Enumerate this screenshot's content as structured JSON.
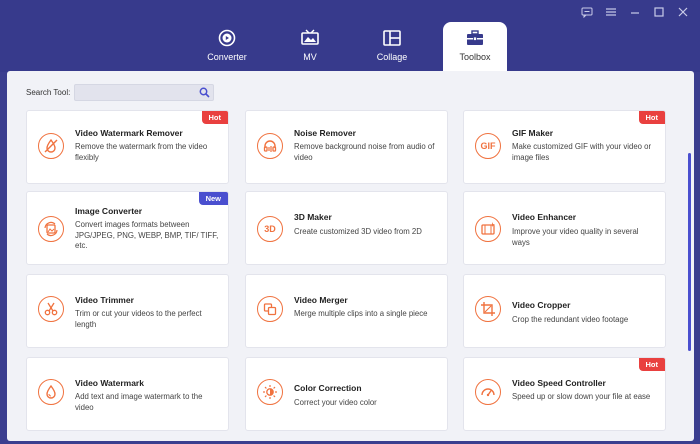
{
  "window": {
    "controls": [
      "feedback-icon",
      "menu-icon",
      "minimize-icon",
      "maximize-icon",
      "close-icon"
    ]
  },
  "tabs": [
    {
      "label": "Converter",
      "icon": "converter-icon",
      "active": false
    },
    {
      "label": "MV",
      "icon": "mv-icon",
      "active": false
    },
    {
      "label": "Collage",
      "icon": "collage-icon",
      "active": false
    },
    {
      "label": "Toolbox",
      "icon": "toolbox-icon",
      "active": true
    }
  ],
  "search": {
    "label": "Search Tool:",
    "value": ""
  },
  "colors": {
    "accent": "#f0723f",
    "hot": "#e9403f",
    "new": "#4a4fcf",
    "header": "#373a8c"
  },
  "tools": [
    {
      "title": "Video Watermark Remover",
      "desc": "Remove the watermark from the video flexibly",
      "badge": "Hot",
      "icon": "watermark-remove-icon"
    },
    {
      "title": "Noise Remover",
      "desc": "Remove background noise from audio of video",
      "badge": "",
      "icon": "noise-remover-icon"
    },
    {
      "title": "GIF Maker",
      "desc": "Make customized GIF with your video or image files",
      "badge": "Hot",
      "icon": "gif-icon"
    },
    {
      "title": "Image Converter",
      "desc": "Convert images formats between JPG/JPEG, PNG, WEBP, BMP, TIF/ TIFF, etc.",
      "badge": "New",
      "icon": "image-converter-icon"
    },
    {
      "title": "3D Maker",
      "desc": "Create customized 3D video from 2D",
      "badge": "",
      "icon": "3d-icon"
    },
    {
      "title": "Video Enhancer",
      "desc": "Improve your video quality in several ways",
      "badge": "",
      "icon": "video-enhancer-icon"
    },
    {
      "title": "Video Trimmer",
      "desc": "Trim or cut your videos to the perfect length",
      "badge": "",
      "icon": "scissors-icon"
    },
    {
      "title": "Video Merger",
      "desc": "Merge multiple clips into a single piece",
      "badge": "",
      "icon": "merge-icon"
    },
    {
      "title": "Video Cropper",
      "desc": "Crop the redundant video footage",
      "badge": "",
      "icon": "crop-icon"
    },
    {
      "title": "Video Watermark",
      "desc": "Add text and image watermark to the video",
      "badge": "",
      "icon": "watermark-drop-icon"
    },
    {
      "title": "Color Correction",
      "desc": "Correct your video color",
      "badge": "",
      "icon": "color-correction-icon"
    },
    {
      "title": "Video Speed Controller",
      "desc": "Speed up or slow down your file at ease",
      "badge": "Hot",
      "icon": "speedometer-icon"
    }
  ]
}
